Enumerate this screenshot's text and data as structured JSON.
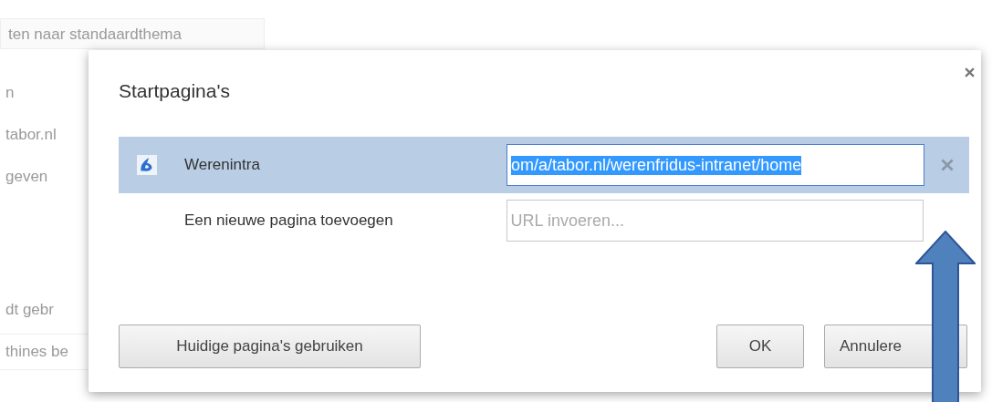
{
  "background": {
    "button": "ten naar standaardthema",
    "texts": [
      "n",
      "tabor.nl",
      "geven"
    ],
    "text_lower": "dt gebr",
    "bottom_button": "thines be"
  },
  "dialog": {
    "title": "Startpagina's",
    "pages": [
      {
        "name": "Werenintra",
        "url": "om/a/tabor.nl/werenfridus-intranet/home",
        "selected": true
      }
    ],
    "new_page": {
      "label": "Een nieuwe pagina toevoegen",
      "placeholder": "URL invoeren..."
    },
    "buttons": {
      "use_current": "Huidige pagina's gebruiken",
      "ok": "OK",
      "cancel": "Annulere"
    }
  }
}
